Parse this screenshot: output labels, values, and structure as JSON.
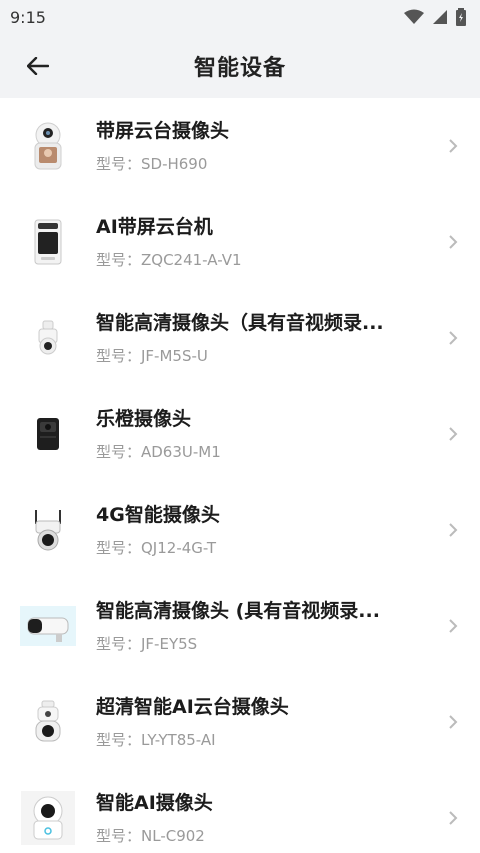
{
  "status": {
    "time": "9:15"
  },
  "header": {
    "title": "智能设备"
  },
  "devices": [
    {
      "name": "带屏云台摄像头",
      "model": "型号：SD-H690",
      "icon": "screen-ptz-camera-icon"
    },
    {
      "name": "AI带屏云台机",
      "model": "型号：ZQC241-A-V1",
      "icon": "ai-screen-ptz-icon"
    },
    {
      "name": "智能高清摄像头（具有音视频录...",
      "model": "型号：JF-M5S-U",
      "icon": "dome-camera-icon"
    },
    {
      "name": "乐橙摄像头",
      "model": "型号：AD63U-M1",
      "icon": "box-camera-icon"
    },
    {
      "name": "4G智能摄像头",
      "model": "型号：QJ12-4G-T",
      "icon": "outdoor-4g-camera-icon"
    },
    {
      "name": "智能高清摄像头 (具有音视频录...",
      "model": "型号：JF-EY5S",
      "icon": "bullet-camera-icon"
    },
    {
      "name": "超清智能AI云台摄像头",
      "model": "型号：LY-YT85-AI",
      "icon": "ptz-ai-camera-icon"
    },
    {
      "name": "智能AI摄像头",
      "model": "型号：NL-C902",
      "icon": "indoor-ai-camera-icon"
    }
  ]
}
